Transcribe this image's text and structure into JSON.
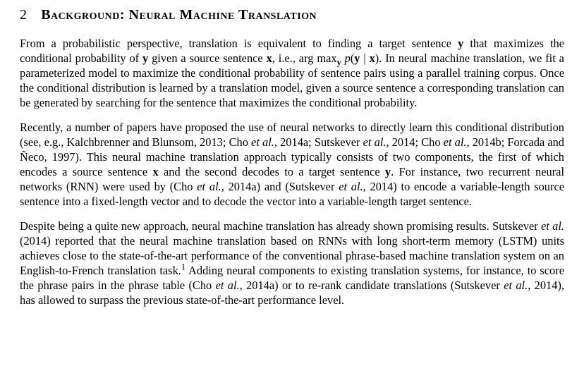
{
  "section": {
    "number": "2",
    "title": "Background: Neural Machine Translation"
  },
  "paragraphs": {
    "p1": {
      "t0": "From a probabilistic perspective, translation is equivalent to finding a target sentence ",
      "y1": "y",
      "t1": " that maximizes the conditional probability of ",
      "y2": "y",
      "t2": " given a source sentence ",
      "x1": "x",
      "t3": ", i.e., arg max",
      "sub_y": "y",
      "t3b": " ",
      "p": "p",
      "t4": "(",
      "y3": "y",
      "bar": " | ",
      "x2": "x",
      "t5": "). In neural machine translation, we fit a parameterized model to maximize the conditional probability of sentence pairs using a parallel training corpus. Once the conditional distribution is learned by a translation model, given a source sentence a corresponding translation can be generated by searching for the sentence that maximizes the conditional probability."
    },
    "p2": {
      "t0": "Recently, a number of papers have proposed the use of neural networks to directly learn this conditional distribution (see, e.g., Kalchbrenner and Blunsom, 2013; Cho ",
      "etal1": "et al.",
      "t1": ", 2014a; Sutskever ",
      "etal2": "et al.",
      "t2": ", 2014; Cho ",
      "etal3": "et al.",
      "t3": ", 2014b; Forcada and Ñeco, 1997). This neural machine translation approach typically consists of two components, the first of which encodes a source sentence ",
      "x1": "x",
      "t4": " and the second decodes to a target sentence ",
      "y1": "y",
      "t5": ". For instance, two recurrent neural networks (RNN) were used by (Cho ",
      "etal4": "et al.",
      "t6": ", 2014a) and (Sutskever ",
      "etal5": "et al.",
      "t7": ", 2014) to encode a variable-length source sentence into a fixed-length vector and to decode the vector into a variable-length target sentence."
    },
    "p3": {
      "t0": "Despite being a quite new approach, neural machine translation has already shown promising results. Sutskever ",
      "etal1": "et al.",
      "t1": " (2014) reported that the neural machine translation based on RNNs with long short-term memory (LSTM) units achieves close to the state-of-the-art performance of the conventional phrase-based machine translation system on an English-to-French translation task.",
      "fn": "1",
      "t2": " Adding neural components to existing translation systems, for instance, to score the phrase pairs in the phrase table (Cho ",
      "etal2": "et al.",
      "t3": ", 2014a) or to re-rank candidate translations (Sutskever ",
      "etal3": "et al.",
      "t4": ", 2014), has allowed to surpass the previous state-of-the-art performance level."
    }
  }
}
